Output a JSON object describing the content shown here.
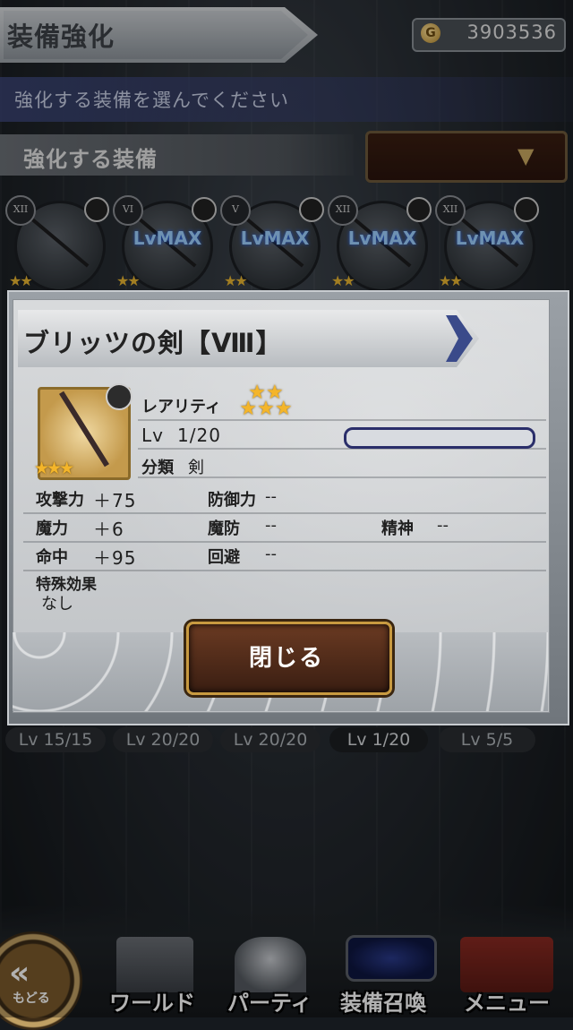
{
  "header": {
    "title": "装備強化",
    "gil": "3903536",
    "instruction": "強化する装備を選んでください",
    "section_label": "強化する装備"
  },
  "equipment_slots": [
    {
      "rank": "XII",
      "lvmax": "",
      "stars": "★★",
      "lv": "Lv 15/15"
    },
    {
      "rank": "VI",
      "lvmax": "LvMAX",
      "stars": "★★",
      "lv": "Lv 20/20"
    },
    {
      "rank": "V",
      "lvmax": "LvMAX",
      "stars": "★★",
      "lv": "Lv 20/20"
    },
    {
      "rank": "XII",
      "lvmax": "LvMAX",
      "stars": "★★",
      "lv": "Lv 1/20"
    },
    {
      "rank": "XII",
      "lvmax": "LvMAX",
      "stars": "★★",
      "lv": "Lv 5/5"
    }
  ],
  "modal": {
    "title": "ブリッツの剣【Ⅷ】",
    "rarity_label": "レアリティ",
    "rarity_stars_top": "★★",
    "rarity_stars_bottom": "★★★",
    "icon_stars": "★★★",
    "level_label": "Lv",
    "level_value": "1/20",
    "exp_progress": 0.0,
    "category_label": "分類",
    "category_value": "剣",
    "stats": {
      "attack_label": "攻撃力",
      "attack_value": "＋75",
      "defense_label": "防御力",
      "defense_value": "--",
      "magic_label": "魔力",
      "magic_value": "＋6",
      "mdef_label": "魔防",
      "mdef_value": "--",
      "spirit_label": "精神",
      "spirit_value": "--",
      "accuracy_label": "命中",
      "accuracy_value": "＋95",
      "evasion_label": "回避",
      "evasion_value": "--"
    },
    "special_label": "特殊効果",
    "special_value": "なし",
    "close_label": "閉じる"
  },
  "nav": {
    "back_label": "もどる",
    "items": [
      "ワールド",
      "パーティ",
      "装備召喚",
      "メニュー"
    ]
  },
  "colors": {
    "gold_star": "#f4b52a",
    "lvmax_blue": "#9ed0ff",
    "close_button": "#3a1e12",
    "close_border": "#c89a40",
    "exp_bar_border": "#2a2e6a"
  }
}
